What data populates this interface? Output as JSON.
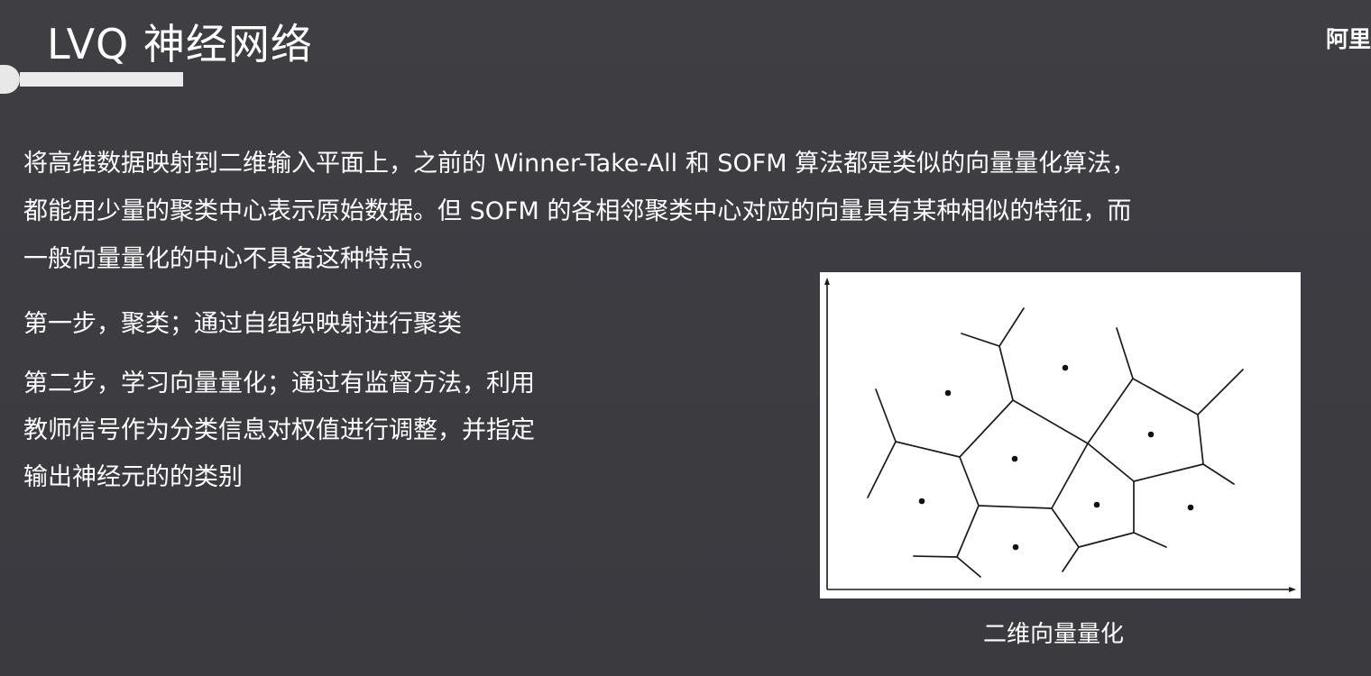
{
  "slide": {
    "title": "LVQ 神经网络",
    "brand": "阿里"
  },
  "intro": {
    "lines": [
      "将高维数据映射到二维输入平面上，之前的 Winner-Take-All 和 SOFM 算法都是类似的向量量化算法，",
      "都能用少量的聚类中心表示原始数据。但 SOFM 的各相邻聚类中心对应的向量具有某种相似的特征，而",
      "一般向量量化的中心不具备这种特点。"
    ]
  },
  "steps": {
    "step1": "第一步，聚类；通过自组织映射进行聚类",
    "step2_lines": [
      "第二步，学习向量量化；通过有监督方法，利用",
      "教师信号作为分类信息对权值进行调整，并指定",
      "输出神经元的的类别"
    ]
  },
  "figure": {
    "caption": "二维向量量化",
    "colors": {
      "background": "#ffffff",
      "lines": "#1a1a1a"
    }
  }
}
